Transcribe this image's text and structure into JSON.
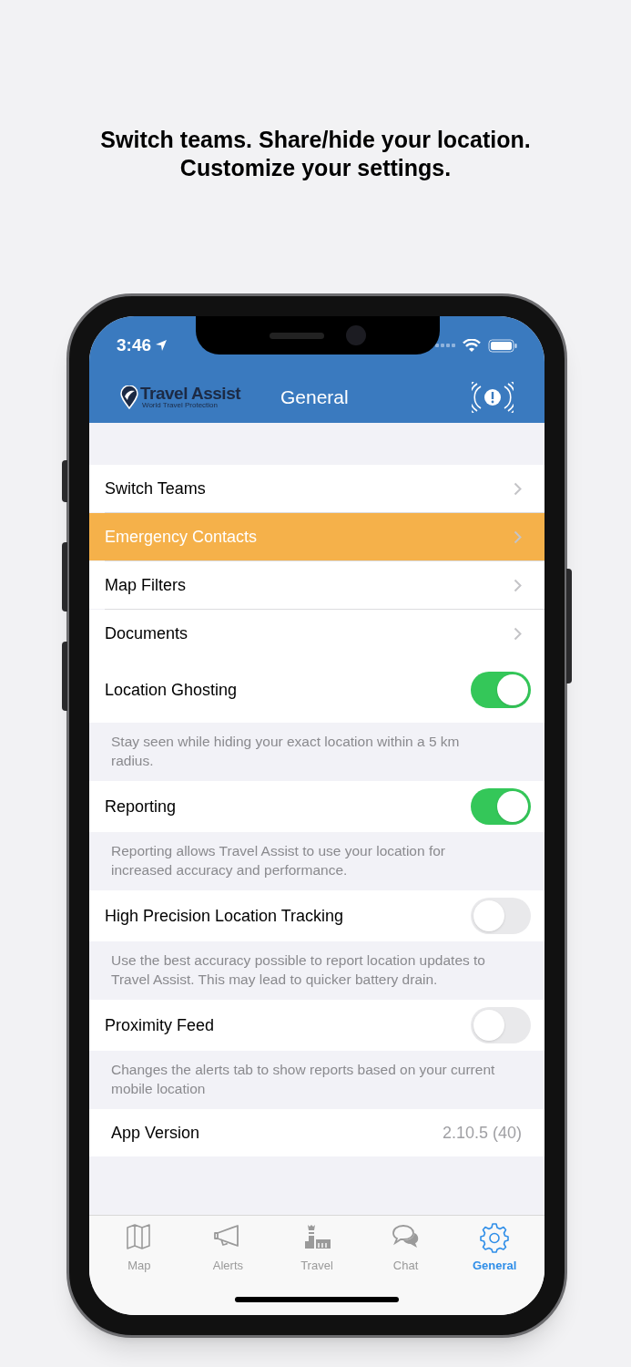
{
  "caption": [
    "Switch teams. Share/hide your location.",
    "Customize your settings."
  ],
  "status_bar": {
    "time": "3:46"
  },
  "header": {
    "brand": "Travel Assist",
    "brand_tagline": "World Travel Protection",
    "title": "General"
  },
  "rows": [
    {
      "kind": "link",
      "label": "Switch Teams",
      "highlighted": false
    },
    {
      "kind": "link",
      "label": "Emergency Contacts",
      "highlighted": true
    },
    {
      "kind": "link",
      "label": "Map Filters",
      "highlighted": false
    },
    {
      "kind": "link",
      "label": "Documents",
      "highlighted": false
    },
    {
      "kind": "toggle",
      "label": "Location Ghosting",
      "on": true,
      "footer": "Stay seen while hiding your exact location within a 5 km radius."
    },
    {
      "kind": "toggle",
      "label": "Reporting",
      "on": true,
      "footer": "Reporting allows Travel Assist to use your location for increased accuracy and performance."
    },
    {
      "kind": "toggle",
      "label": "High Precision Location Tracking",
      "on": false,
      "footer": "Use the best accuracy possible to report location updates to Travel Assist. This may lead to quicker battery drain."
    },
    {
      "kind": "toggle",
      "label": "Proximity Feed",
      "on": false,
      "footer": "Changes the alerts tab to show reports based on your current mobile location"
    },
    {
      "kind": "value",
      "label": "App Version",
      "value": "2.10.5 (40)"
    }
  ],
  "tabs": [
    {
      "label": "Map",
      "selected": false
    },
    {
      "label": "Alerts",
      "selected": false
    },
    {
      "label": "Travel",
      "selected": false
    },
    {
      "label": "Chat",
      "selected": false
    },
    {
      "label": "General",
      "selected": true
    }
  ]
}
